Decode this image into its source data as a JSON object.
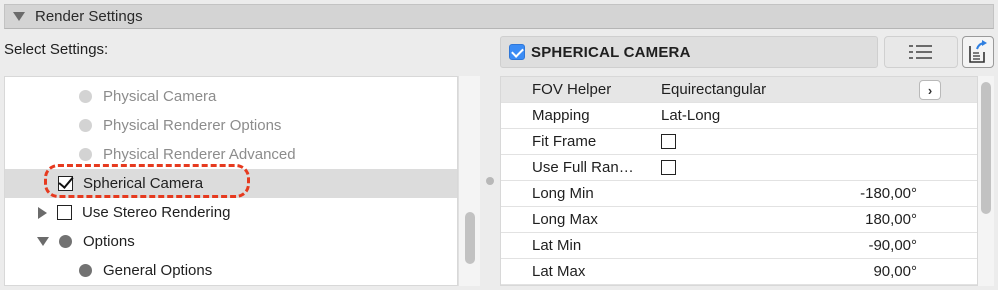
{
  "header": {
    "title": "Render Settings"
  },
  "select_settings_label": "Select Settings:",
  "camera_bar": {
    "title": "SPHERICAL CAMERA",
    "checked": true
  },
  "tree": [
    {
      "label": "Physical Camera",
      "state": "disabled"
    },
    {
      "label": "Physical Renderer Options",
      "state": "disabled"
    },
    {
      "label": "Physical Renderer Advanced",
      "state": "disabled"
    },
    {
      "label": "Spherical Camera",
      "state": "checked",
      "selected": true
    },
    {
      "label": "Use Stereo Rendering",
      "state": "unchecked",
      "expander": "collapsed"
    },
    {
      "label": "Options",
      "state": "group",
      "expander": "expanded"
    },
    {
      "label": "General Options",
      "state": "group-item"
    }
  ],
  "properties": [
    {
      "name": "FOV Helper",
      "value": "Equirectangular"
    },
    {
      "name": "Mapping",
      "value": "Lat-Long"
    },
    {
      "name": "Fit Frame",
      "value": ""
    },
    {
      "name": "Use Full Ran…",
      "value": ""
    },
    {
      "name": "Long Min",
      "value": "-180,00°"
    },
    {
      "name": "Long Max",
      "value": "180,00°"
    },
    {
      "name": "Lat Min",
      "value": "-90,00°"
    },
    {
      "name": "Lat Max",
      "value": "90,00°"
    }
  ],
  "icons": {
    "collapse": "triangle-down-icon",
    "list": "list-view-icon",
    "export": "export-document-icon",
    "chevron": "chevron-right-icon"
  }
}
